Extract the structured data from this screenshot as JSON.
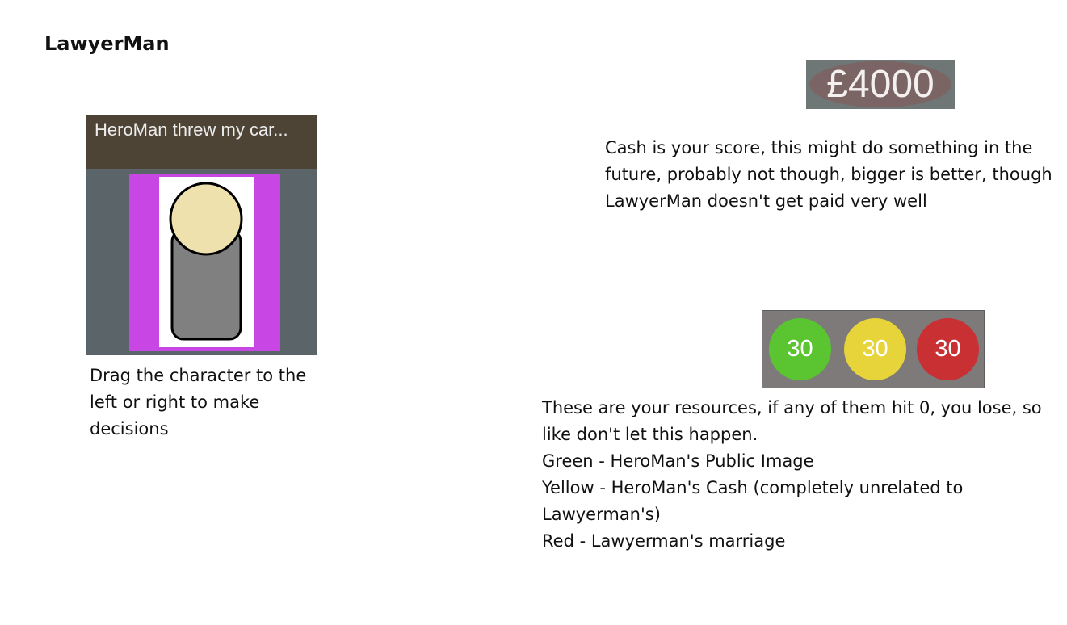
{
  "title": "LawyerMan",
  "card": {
    "header_text": "HeroMan threw my car...",
    "colors": {
      "header_bg": "#4e4436",
      "card_bg": "#5b6468",
      "frame": "#c846e4",
      "portrait_bg": "#ffffff",
      "head": "#efe1ae",
      "body": "#808080"
    }
  },
  "instructions": {
    "drag": "Drag the character to the left or right to make decisions",
    "cash": "Cash is your score, this might do something in the future, probably not though, bigger is better, though LawyerMan doesn't get paid very well"
  },
  "cash": {
    "display": "£4000",
    "colors": {
      "box": "#6f7676",
      "ellipse": "#7b6464"
    }
  },
  "resources": {
    "items": [
      {
        "icon": "green-resource",
        "value": "30",
        "color": "#5ac530"
      },
      {
        "icon": "yellow-resource",
        "value": "30",
        "color": "#e6d43a"
      },
      {
        "icon": "red-resource",
        "value": "30",
        "color": "#c83034"
      }
    ],
    "lines": [
      "These are your resources, if any of them hit 0, you lose, so like don't let this happen.",
      "Green - HeroMan's Public Image",
      "Yellow - HeroMan's Cash (completely unrelated to Lawyerman's)",
      "Red - Lawyerman's marriage"
    ]
  }
}
